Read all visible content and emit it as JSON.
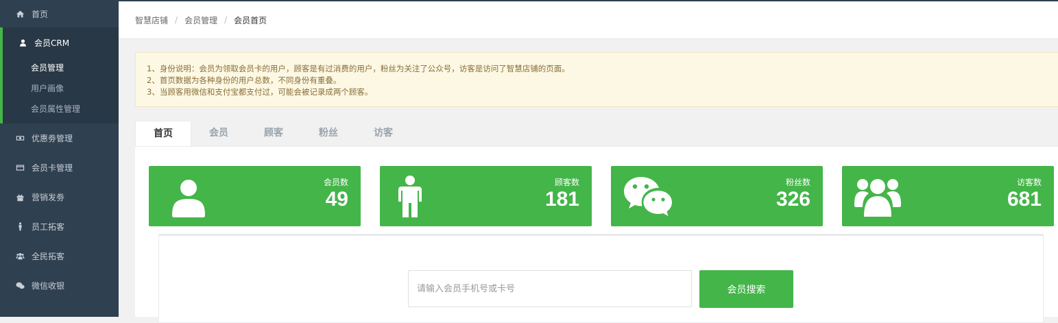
{
  "sidebar": {
    "items": [
      {
        "label": "首页",
        "icon": "home-icon"
      },
      {
        "label": "会员CRM",
        "icon": "user-icon"
      },
      {
        "label": "优惠劵管理",
        "icon": "money-icon"
      },
      {
        "label": "会员卡管理",
        "icon": "credit-card-icon"
      },
      {
        "label": "营销发劵",
        "icon": "gift-icon"
      },
      {
        "label": "员工拓客",
        "icon": "male-icon"
      },
      {
        "label": "全民拓客",
        "icon": "users-icon"
      },
      {
        "label": "微信收银",
        "icon": "wechat-icon"
      }
    ],
    "sub_items": [
      {
        "label": "会员管理",
        "active": true
      },
      {
        "label": "用户画像",
        "active": false
      },
      {
        "label": "会员属性管理",
        "active": false
      }
    ]
  },
  "breadcrumb": [
    "智慧店铺",
    "会员管理",
    "会员首页"
  ],
  "notice": [
    "1、身份说明：会员为领取会员卡的用户，顾客是有过消费的用户，粉丝为关注了公众号，访客是访问了智慧店铺的页面。",
    "2、首页数据为各种身份的用户总数，不同身份有重叠。",
    "3、当顾客用微信和支付宝都支付过，可能会被记录成两个顾客。"
  ],
  "tabs": [
    "首页",
    "会员",
    "顾客",
    "粉丝",
    "访客"
  ],
  "stats": [
    {
      "label": "会员数",
      "value": "49",
      "icon": "user-icon"
    },
    {
      "label": "顾客数",
      "value": "181",
      "icon": "male-icon"
    },
    {
      "label": "粉丝数",
      "value": "326",
      "icon": "wechat-icon"
    },
    {
      "label": "访客数",
      "value": "681",
      "icon": "users-icon"
    }
  ],
  "search": {
    "placeholder": "请输入会员手机号或卡号",
    "button_label": "会员搜索"
  },
  "colors": {
    "accent": "#44b549",
    "sidebar": "#2f4050"
  }
}
